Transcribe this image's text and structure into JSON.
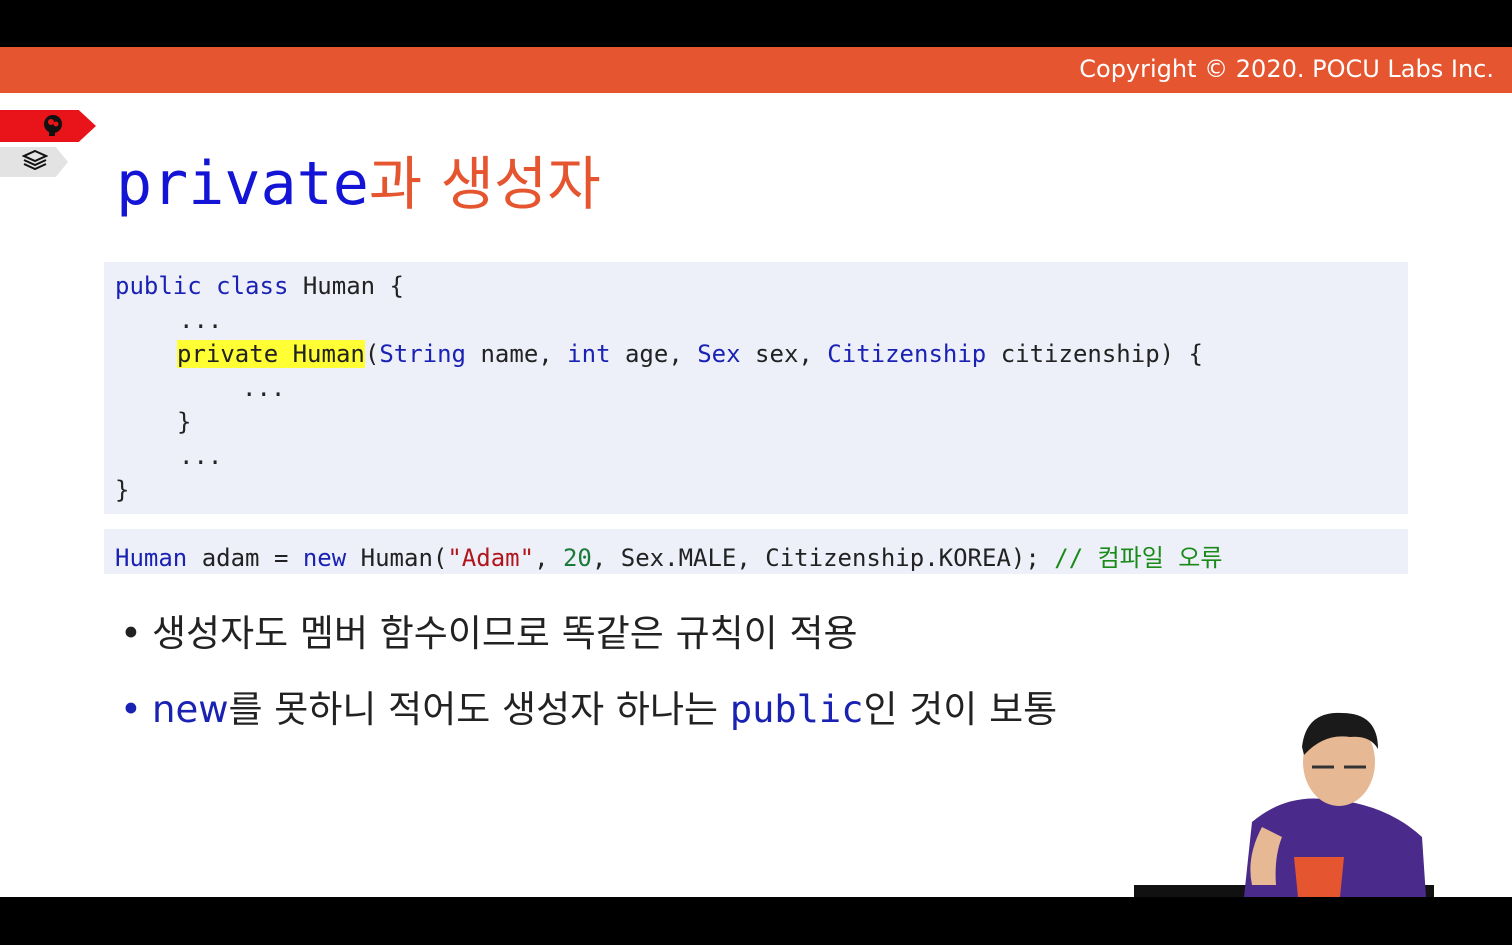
{
  "header": {
    "copyright": "Copyright © 2020. POCU Labs Inc."
  },
  "side_tabs": [
    {
      "icon": "brain-icon"
    },
    {
      "icon": "layers-icon"
    }
  ],
  "title": {
    "mono": "private",
    "korean": "과 생성자"
  },
  "code": {
    "line1": {
      "kw1": "public",
      "kw2": "class",
      "rest": " Human {"
    },
    "line2": "...",
    "line3": {
      "private": "private",
      "human": " Human",
      "open": "(",
      "t1": "String",
      "p1": " name, ",
      "t2": "int",
      "p2": " age, ",
      "t3": "Sex",
      "p3": " sex, ",
      "t4": "Citizenship",
      "p4": " citizenship) {"
    },
    "line4": "...",
    "line5": "}",
    "line6": "...",
    "line7": "}"
  },
  "code2": {
    "type": "Human",
    "a": " adam = ",
    "new": "new",
    "b": " Human(",
    "str": "\"Adam\"",
    "c": ", ",
    "num": "20",
    "d": ", Sex.MALE, Citizenship.KOREA); ",
    "comment": "// 컴파일 오류"
  },
  "bullets": {
    "b1": "생성자도 멤버 함수이므로 똑같은 규칙이 적용",
    "b2": {
      "new": "new",
      "t1": "를 못하니 적어도 생성자 하나는 ",
      "public": "public",
      "t2": "인 것이 보통"
    }
  },
  "colors": {
    "accent": "#e5552f",
    "keyword": "#1a22b4",
    "highlight": "#ffff33",
    "code_bg": "#eef0f9"
  }
}
